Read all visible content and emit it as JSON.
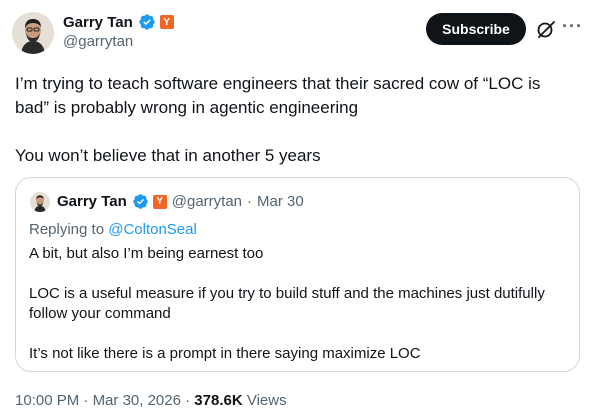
{
  "author": {
    "name": "Garry Tan",
    "handle": "@garrytan",
    "yc_badge": "Y",
    "verified_color": "#1d9bf0",
    "yc_color": "#f26625"
  },
  "actions": {
    "subscribe_label": "Subscribe",
    "grok_icon": "grok-icon",
    "more_label": "···"
  },
  "tweet": {
    "paragraphs": [
      "I’m trying to teach software engineers that their sacred cow of “LOC is bad” is probably wrong in agentic engineering",
      "You won’t believe that in another 5 years"
    ]
  },
  "quote": {
    "name": "Garry Tan",
    "handle": "@garrytan",
    "sep": "·",
    "date": "Mar 30",
    "replying_prefix": "Replying to ",
    "replying_to": "@ColtonSeal",
    "paragraphs": [
      "A bit, but also I’m being earnest too",
      "LOC is a useful measure if you try to build stuff and the machines just dutifully follow your command",
      "It’s not like there is a prompt in there saying maximize LOC"
    ]
  },
  "meta": {
    "time": "10:00 PM",
    "sep1": "·",
    "date": "Mar 30, 2026",
    "sep2": "·",
    "views_count": "378.6K",
    "views_label": "Views"
  }
}
